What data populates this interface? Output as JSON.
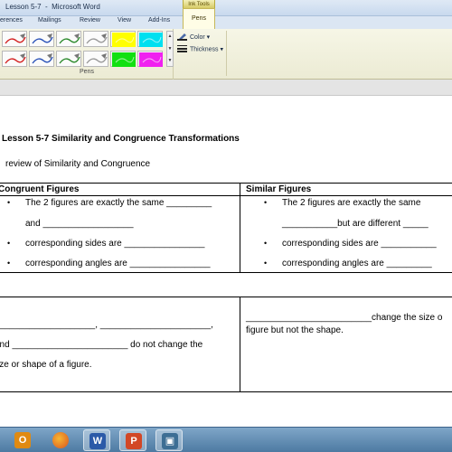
{
  "window": {
    "title": "Lesson 5-7  -  Microsoft Word",
    "contextual_tab": "Ink Tools"
  },
  "ribbon": {
    "tabs": [
      "erences",
      "Mailings",
      "Review",
      "View",
      "Add-Ins"
    ],
    "active_tab": "Pens",
    "pens_group_label": "Pens",
    "color_label": "Color",
    "thickness_label": "Thickness",
    "pen_colors": [
      [
        "#d32020",
        "#2a52b8",
        "#2c8a2c",
        "#9a9a9a",
        "#ffff00",
        "#00e0f0"
      ],
      [
        "#d32020",
        "#2a52b8",
        "#2c8a2c",
        "#9a9a9a",
        "#12e012",
        "#f020f0"
      ]
    ]
  },
  "document": {
    "title": "Lesson 5-7 Similarity and Congruence Transformations",
    "subtitle": "review of Similarity and Congruence",
    "table1": {
      "col1_header": "Congruent Figures",
      "col2_header": "Similar Figures",
      "col1_items": [
        "The 2 figures are exactly the same _________",
        "and __________________",
        "corresponding sides are ________________",
        "corresponding angles are ________________"
      ],
      "col2_items": [
        "The 2 figures are exactly the same",
        "___________but are different _____",
        "corresponding sides are ___________",
        "corresponding angles are _________"
      ]
    },
    "table2": {
      "col1_lines": [
        "____________________, ______________________,",
        "and _______________________ do not change the",
        "size or shape of a figure."
      ],
      "col2_lines": [
        "_________________________change the size o",
        "figure but not the shape."
      ]
    }
  },
  "taskbar": {
    "apps": [
      "outlook-icon",
      "firefox-icon",
      "word-icon",
      "powerpoint-icon",
      "network-app-icon"
    ]
  }
}
